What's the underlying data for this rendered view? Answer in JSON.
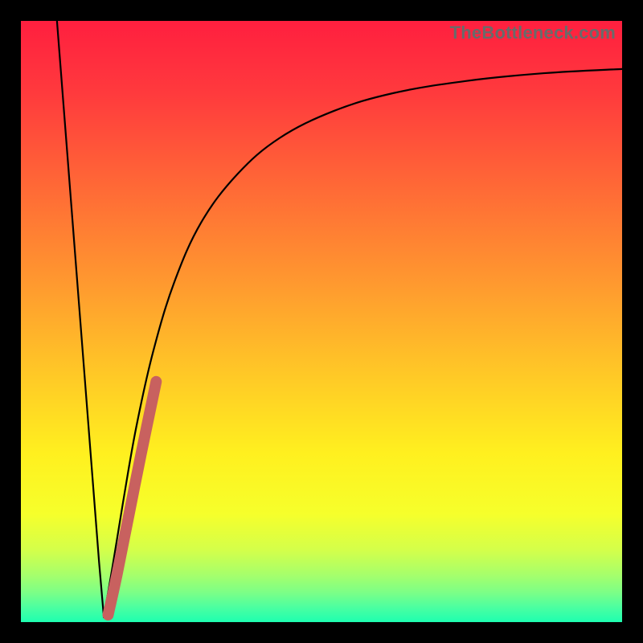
{
  "watermark": "TheBottleneck.com",
  "colors": {
    "frame": "#000000",
    "gradient_stops": [
      {
        "offset": 0.0,
        "color": "#ff1f3f"
      },
      {
        "offset": 0.12,
        "color": "#ff3a3d"
      },
      {
        "offset": 0.28,
        "color": "#ff6a36"
      },
      {
        "offset": 0.44,
        "color": "#ff9a2f"
      },
      {
        "offset": 0.58,
        "color": "#ffc627"
      },
      {
        "offset": 0.72,
        "color": "#fff01f"
      },
      {
        "offset": 0.82,
        "color": "#f6ff2b"
      },
      {
        "offset": 0.88,
        "color": "#d4ff4a"
      },
      {
        "offset": 0.92,
        "color": "#a8ff6a"
      },
      {
        "offset": 0.95,
        "color": "#7dff86"
      },
      {
        "offset": 0.975,
        "color": "#4cffa0"
      },
      {
        "offset": 1.0,
        "color": "#1effb0"
      }
    ],
    "curve_stroke": "#000000",
    "highlight_stroke": "#c8615f"
  },
  "chart_data": {
    "type": "line",
    "title": "",
    "xlabel": "",
    "ylabel": "",
    "x_range": [
      0,
      100
    ],
    "y_range": [
      0,
      100
    ],
    "series": [
      {
        "name": "left-branch",
        "x": [
          6.0,
          7.4,
          8.8,
          10.2,
          11.6,
          13.0,
          13.8
        ],
        "y": [
          100.0,
          82.0,
          64.0,
          46.0,
          28.0,
          10.0,
          0.8
        ]
      },
      {
        "name": "right-branch",
        "x": [
          13.8,
          15.2,
          17.0,
          19.2,
          22.0,
          25.5,
          30.0,
          36.0,
          43.0,
          52.0,
          62.0,
          74.0,
          87.0,
          100.0
        ],
        "y": [
          0.8,
          9.0,
          20.0,
          32.5,
          45.0,
          56.5,
          66.5,
          74.5,
          80.5,
          85.0,
          88.0,
          90.0,
          91.3,
          92.0
        ]
      }
    ],
    "highlight_segment": {
      "series": "right-branch",
      "x": [
        14.5,
        16.0,
        18.0,
        20.0,
        22.5
      ],
      "y": [
        1.2,
        8.0,
        18.0,
        28.0,
        40.0
      ]
    }
  }
}
